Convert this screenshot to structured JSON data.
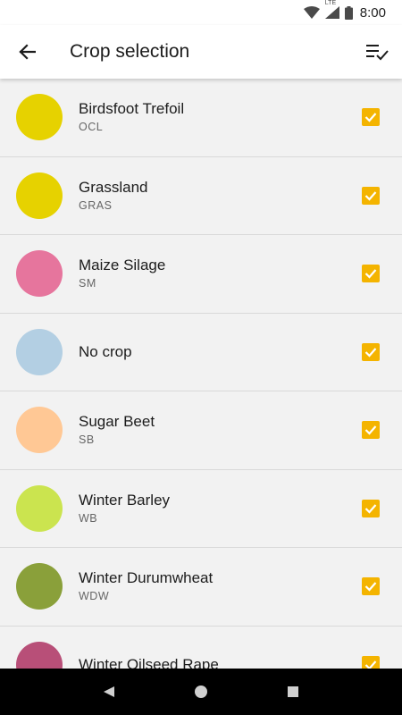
{
  "status_bar": {
    "network_label": "LTE",
    "time": "8:00"
  },
  "app_bar": {
    "title": "Crop selection",
    "back_icon": "arrow-back-icon",
    "filter_icon": "list-check-icon"
  },
  "colors": {
    "accent": "#f4b400",
    "background": "#f2f2f2"
  },
  "crops": [
    {
      "name": "Birdsfoot Trefoil",
      "code": "OCL",
      "color": "#e6d200",
      "checked": true
    },
    {
      "name": "Grassland",
      "code": "GRAS",
      "color": "#e6d200",
      "checked": true
    },
    {
      "name": "Maize Silage",
      "code": "SM",
      "color": "#e6759d",
      "checked": true
    },
    {
      "name": "No crop",
      "code": "",
      "color": "#b3cfe3",
      "checked": true
    },
    {
      "name": "Sugar Beet",
      "code": "SB",
      "color": "#ffc895",
      "checked": true
    },
    {
      "name": "Winter Barley",
      "code": "WB",
      "color": "#cbe44f",
      "checked": true
    },
    {
      "name": "Winter Durumwheat",
      "code": "WDW",
      "color": "#8aa03a",
      "checked": true
    },
    {
      "name": "Winter Oilseed Rape",
      "code": "",
      "color": "#b84f78",
      "checked": true
    }
  ],
  "nav_bar": {
    "back_icon": "nav-back-triangle-icon",
    "home_icon": "nav-home-circle-icon",
    "recents_icon": "nav-recents-square-icon"
  }
}
